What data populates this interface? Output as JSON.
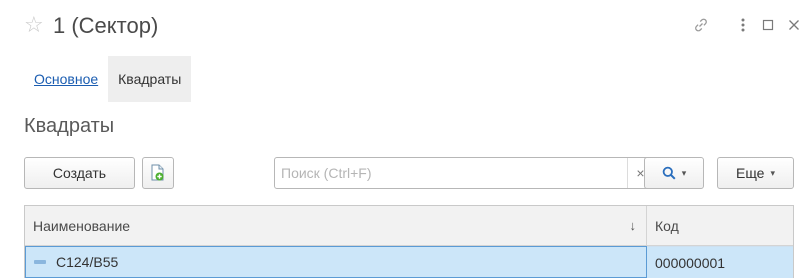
{
  "window": {
    "title": "1 (Сектор)",
    "star_glyph": "☆",
    "link_icon": "link-icon",
    "more_icon": "more-vertical-icon",
    "maximize_glyph": "☐",
    "close_glyph": "✕"
  },
  "tabs": [
    {
      "label": "Основное",
      "active": false
    },
    {
      "label": "Квадраты",
      "active": true
    }
  ],
  "section": {
    "title": "Квадраты"
  },
  "toolbar": {
    "create_label": "Создать",
    "search_placeholder": "Поиск (Ctrl+F)",
    "search_clear_glyph": "×",
    "more_label": "Еще",
    "caret_glyph": "▾"
  },
  "table": {
    "columns": [
      {
        "label": "Наименование",
        "sorted": "descending",
        "sort_glyph": "↓"
      },
      {
        "label": "Код"
      }
    ],
    "rows": [
      {
        "name": "С124/В55",
        "code": "000000001",
        "selected": true
      }
    ]
  },
  "colors": {
    "link": "#1b5db1",
    "selected_row": "#cce6f9",
    "selected_border": "#5b9bd5"
  }
}
